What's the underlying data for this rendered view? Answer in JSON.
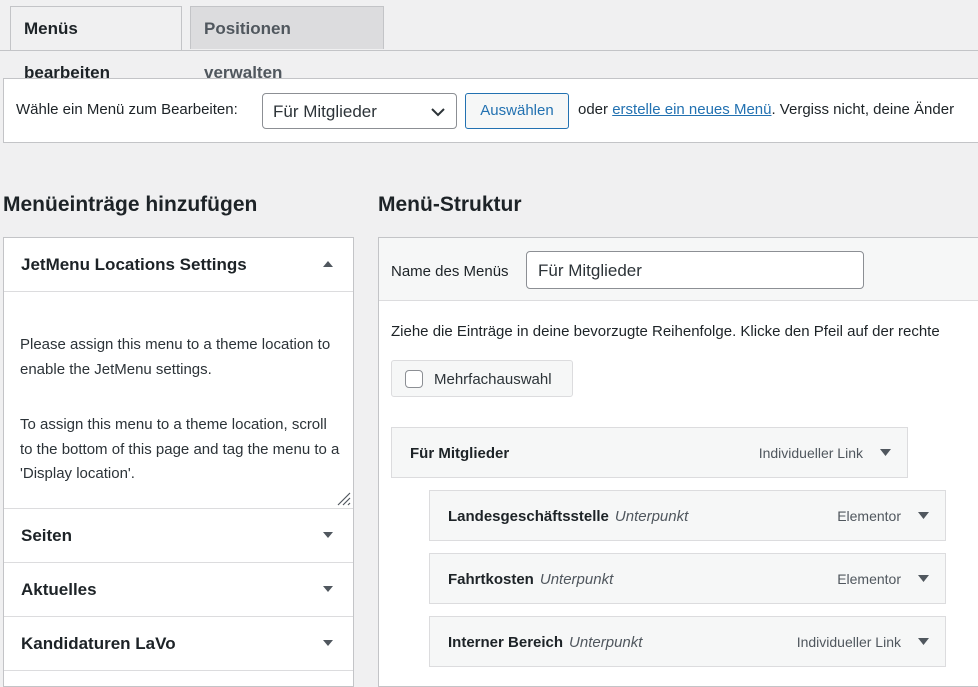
{
  "tabs": {
    "edit": "Menüs bearbeiten",
    "locations": "Positionen verwalten"
  },
  "select_bar": {
    "label": "Wähle ein Menü zum Bearbeiten:",
    "selected_menu": "Für Mitglieder",
    "choose_button": "Auswählen",
    "text_before_link": "oder ",
    "create_link": "erstelle ein neues Menü",
    "text_after_link": ". Vergiss nicht, deine Änder"
  },
  "left": {
    "heading": "Menüeinträge hinzufügen",
    "jetmenu": {
      "title": "JetMenu Locations Settings",
      "para1": "Please assign this menu to a theme location to enable the JetMenu settings.",
      "para2": "To assign this menu to a theme location, scroll to the bottom of this page and tag the menu to a 'Display location'."
    },
    "sections": [
      {
        "title": "Seiten"
      },
      {
        "title": "Aktuelles"
      },
      {
        "title": "Kandidaturen LaVo"
      }
    ]
  },
  "right": {
    "heading": "Menü-Struktur",
    "name_label": "Name des Menüs",
    "name_value": "Für Mitglieder",
    "hint": "Ziehe die Einträge in deine bevorzugte Reihenfolge. Klicke den Pfeil auf der rechte",
    "multiselect": "Mehrfachauswahl",
    "items": [
      {
        "title": "Für Mitglieder",
        "subtitle": "",
        "type": "Individueller Link"
      },
      {
        "title": "Landesgeschäftsstelle",
        "subtitle": "Unterpunkt",
        "type": "Elementor"
      },
      {
        "title": "Fahrtkosten",
        "subtitle": "Unterpunkt",
        "type": "Elementor"
      },
      {
        "title": "Interner Bereich",
        "subtitle": "Unterpunkt",
        "type": "Individueller Link"
      }
    ]
  },
  "colors": {
    "accent": "#2271b1",
    "background": "#f0f0f1",
    "border": "#c3c4c7"
  }
}
